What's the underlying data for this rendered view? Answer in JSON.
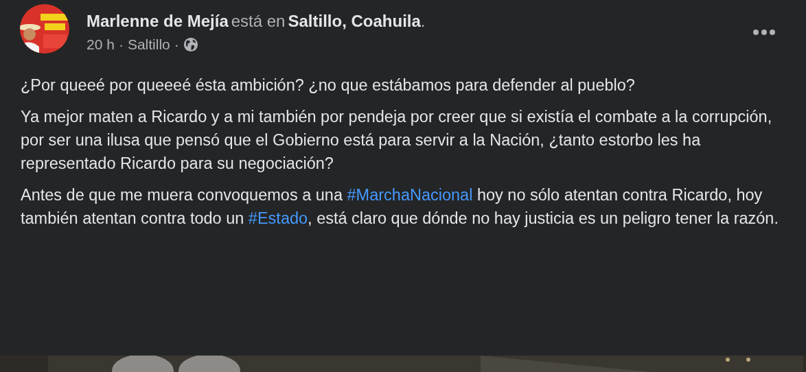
{
  "post": {
    "author": "Marlenne de Mejía",
    "connector": "está en",
    "place": "Saltillo, Coahuila",
    "after_place": ".",
    "time": "20 h",
    "location": "Saltillo",
    "separator": "·",
    "avatar": {
      "kind": "picture"
    },
    "paragraphs": [
      [
        {
          "kind": "text",
          "text": "¿Por queeé por queeeé ésta ambición? ¿no que estábamos para defender al pueblo?"
        }
      ],
      [
        {
          "kind": "text",
          "text": "Ya mejor maten a Ricardo y a mi también por pendeja por creer que si existía el combate a la corrupción, por ser una ilusa que pensó que el Gobierno está para servir a la Nación, ¿tanto estorbo les ha representado Ricardo para su negociación?"
        }
      ],
      [
        {
          "kind": "text",
          "text": "Antes de que me muera convoquemos a una "
        },
        {
          "kind": "hashtag",
          "text": "#MarchaNacional"
        },
        {
          "kind": "text",
          "text": " hoy no sólo atentan contra Ricardo, hoy también atentan contra todo un "
        },
        {
          "kind": "hashtag",
          "text": "#Estado"
        },
        {
          "kind": "text",
          "text": ", está claro que dónde no hay justicia es un peligro tener la razón."
        }
      ]
    ],
    "media": {
      "kind": "picture"
    }
  }
}
